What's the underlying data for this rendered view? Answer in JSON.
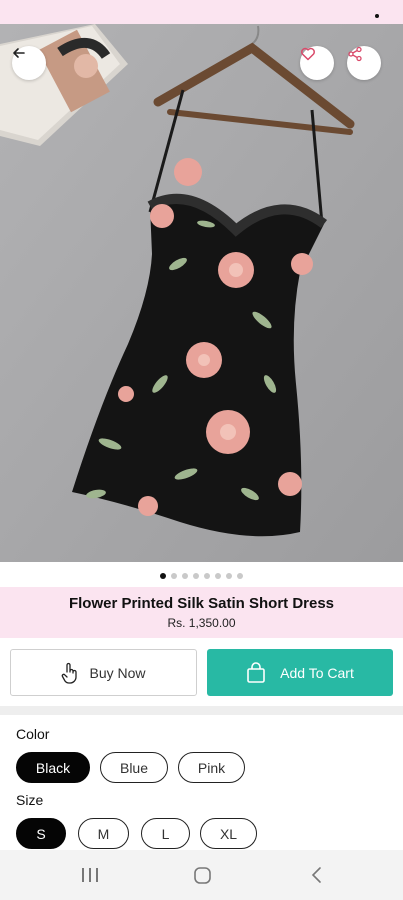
{
  "header": {
    "back_icon": "back-arrow-icon",
    "favorite_icon": "heart-icon",
    "share_icon": "share-icon"
  },
  "gallery": {
    "image_count": 8,
    "active_index": 0
  },
  "product": {
    "title": "Flower Printed Silk Satin Short Dress",
    "price": "Rs. 1,350.00"
  },
  "actions": {
    "buy_now_label": "Buy Now",
    "buy_now_icon": "hand-pointer-icon",
    "add_to_cart_label": "Add To Cart",
    "add_to_cart_icon": "shopping-bag-icon"
  },
  "options": {
    "color_label": "Color",
    "colors": [
      "Black",
      "Blue",
      "Pink"
    ],
    "selected_color": "Black",
    "size_label": "Size",
    "sizes": [
      "S",
      "M",
      "L",
      "XL"
    ],
    "selected_size": "S"
  },
  "theme": {
    "accent": "#28b9a4",
    "band": "#fbe4f0"
  }
}
